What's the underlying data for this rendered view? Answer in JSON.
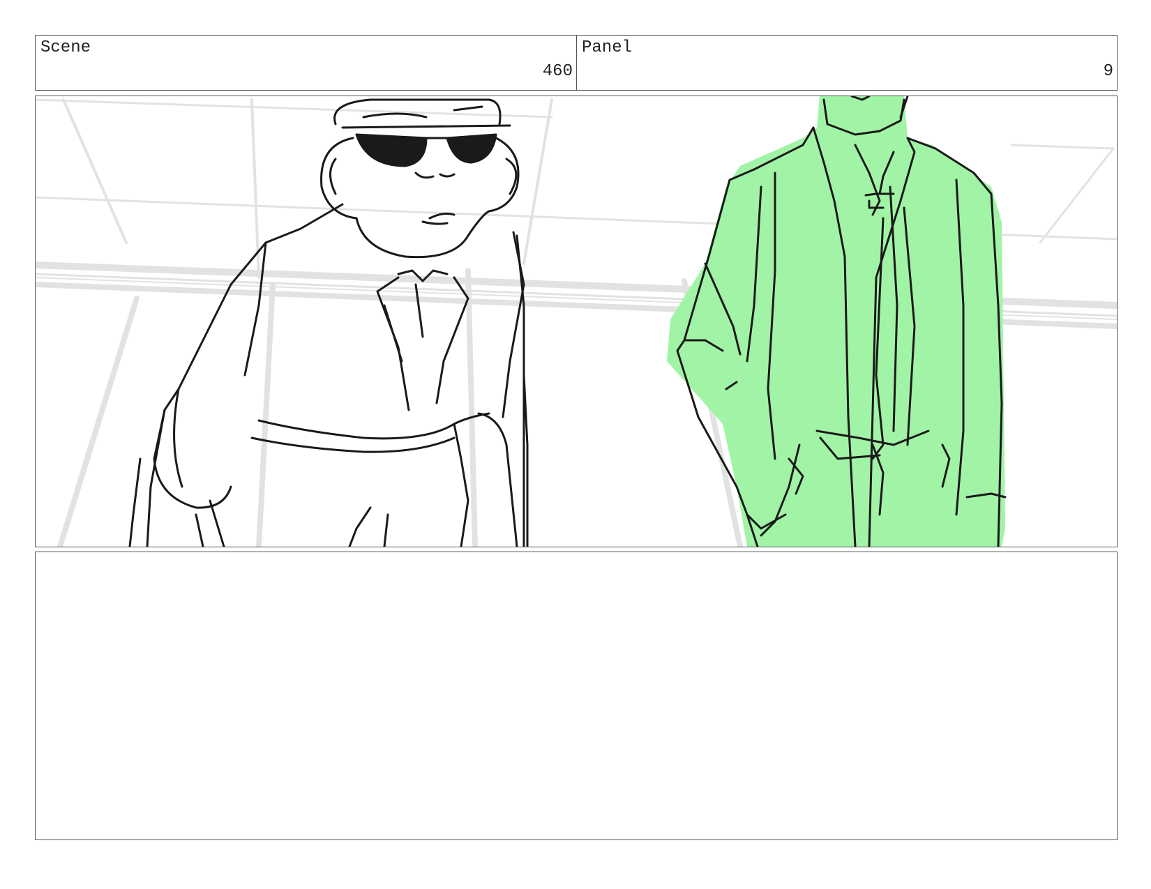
{
  "header": {
    "scene_label": "Scene",
    "scene_number": "460",
    "panel_label": "Panel",
    "panel_number": "9"
  },
  "drawing": {
    "figure_fill_color": "#a1f4a6",
    "line_color": "#1a1a1a",
    "background_line_color": "#e2e2e2"
  },
  "notes": {
    "text": ""
  }
}
